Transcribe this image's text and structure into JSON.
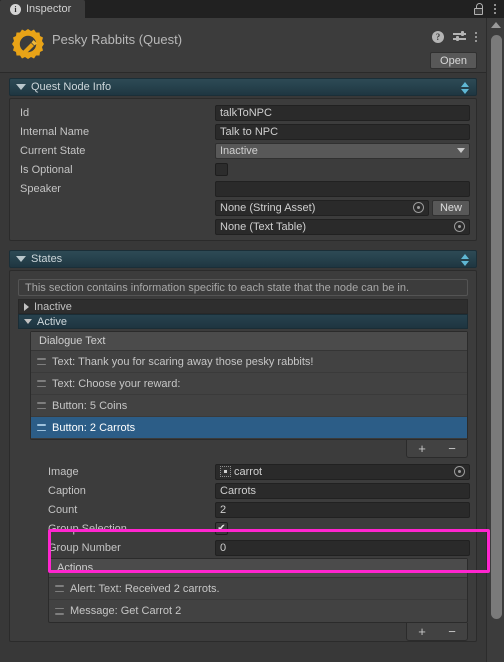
{
  "window": {
    "tab_label": "Inspector",
    "tab_icon": "info-icon",
    "lock_icon": "lock-open-icon",
    "menu_icon": "kebab-menu-icon"
  },
  "header": {
    "object_icon": "quest-gear-icon",
    "title": "Pesky Rabbits (Quest)",
    "help_icon": "help-icon",
    "preset_icon": "preset-settings-icon",
    "menu_icon": "kebab-menu-icon",
    "open_label": "Open"
  },
  "quest_node_info": {
    "title": "Quest Node Info",
    "rows": [
      {
        "label": "Id",
        "value": "talkToNPC",
        "type": "text"
      },
      {
        "label": "Internal Name",
        "value": "Talk to NPC",
        "type": "text"
      },
      {
        "label": "Current State",
        "value": "Inactive",
        "type": "dropdown"
      },
      {
        "label": "Is Optional",
        "value": "",
        "type": "checkbox",
        "checked": false
      },
      {
        "label": "Speaker",
        "value": "",
        "type": "text"
      }
    ],
    "speaker_extra": [
      {
        "value": "None (String Asset)",
        "picker": "object-picker-icon",
        "button": "New"
      },
      {
        "value": "None (Text Table)",
        "picker": "object-picker-icon",
        "button": ""
      }
    ]
  },
  "states": {
    "title": "States",
    "help_text": "This section contains information specific to each state that the node can be in.",
    "items": [
      {
        "label": "Inactive",
        "expanded": false
      },
      {
        "label": "Active",
        "expanded": true
      }
    ],
    "dialogue_list": {
      "header": "Dialogue Text",
      "items": [
        {
          "label": "Text: Thank you for scaring away those pesky rabbits!",
          "selected": false
        },
        {
          "label": "Text: Choose your reward:",
          "selected": false
        },
        {
          "label": "Button: 5 Coins",
          "selected": false
        },
        {
          "label": "Button: 2 Carrots",
          "selected": true
        }
      ],
      "add_label": "+",
      "remove_label": "−"
    },
    "selected_item_fields": [
      {
        "label": "Image",
        "value": "carrot",
        "type": "object",
        "thumb": "sprite-thumbnail-icon"
      },
      {
        "label": "Caption",
        "value": "Carrots",
        "type": "text"
      },
      {
        "label": "Count",
        "value": "2",
        "type": "text"
      },
      {
        "label": "Group Selection",
        "value": "",
        "type": "checkbox",
        "checked": true
      },
      {
        "label": "Group Number",
        "value": "0",
        "type": "text"
      }
    ],
    "actions_list": {
      "header": "Actions",
      "items": [
        {
          "label": "Alert: Text: Received 2 carrots."
        },
        {
          "label": "Message: Get Carrot 2"
        }
      ],
      "add_label": "+",
      "remove_label": "−"
    }
  },
  "highlight": {
    "color": "#ff25cf"
  }
}
